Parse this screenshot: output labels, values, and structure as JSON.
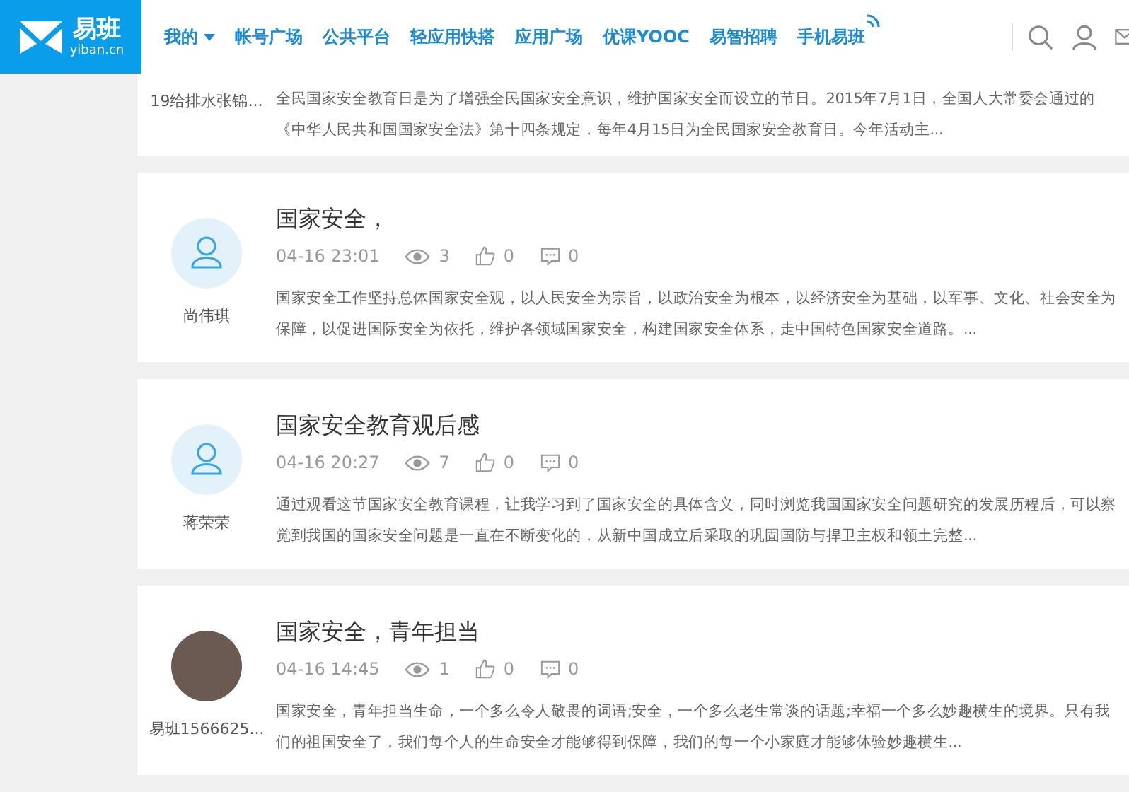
{
  "logo": {
    "name": "易班",
    "domain": "yiban.cn"
  },
  "nav": [
    {
      "label": "我的",
      "dropdown": true,
      "signal": false
    },
    {
      "label": "帐号广场",
      "dropdown": false,
      "signal": false
    },
    {
      "label": "公共平台",
      "dropdown": false,
      "signal": false
    },
    {
      "label": "轻应用快搭",
      "dropdown": false,
      "signal": false
    },
    {
      "label": "应用广场",
      "dropdown": false,
      "signal": false
    },
    {
      "label": "优课YOOC",
      "dropdown": false,
      "signal": false
    },
    {
      "label": "易智招聘",
      "dropdown": false,
      "signal": false
    },
    {
      "label": "手机易班",
      "dropdown": false,
      "signal": true
    }
  ],
  "posts": [
    {
      "user": "19给排水张锦...",
      "excerpt": "全民国家安全教育日是为了增强全民国家安全意识，维护国家安全而设立的节日。2015年7月1日，全国人大常委会通过的《中华人民共和国国家安全法》第十四条规定，每年4月15日为全民国家安全教育日。今年活动主..."
    },
    {
      "kind": "default",
      "user": "尚伟琪",
      "title": "国家安全，",
      "time": "04-16 23:01",
      "views": "3",
      "likes": "0",
      "comments": "0",
      "excerpt": "国家安全工作坚持总体国家安全观，以人民安全为宗旨，以政治安全为根本，以经济安全为基础，以军事、文化、社会安全为保障，以促进国际安全为依托，维护各领域国家安全，构建国家安全体系，走中国特色国家安全道路。..."
    },
    {
      "kind": "default",
      "user": "蒋荣荣",
      "title": "国家安全教育观后感",
      "time": "04-16 20:27",
      "views": "7",
      "likes": "0",
      "comments": "0",
      "excerpt": "通过观看这节国家安全教育课程，让我学习到了国家安全的具体含义，同时浏览我国国家安全问题研究的发展历程后，可以察觉到我国的国家安全问题是一直在不断变化的，从新中国成立后采取的巩固国防与捍卫主权和领土完整..."
    },
    {
      "kind": "photo",
      "user": "易班1566625...",
      "title": "国家安全，青年担当",
      "time": "04-16 14:45",
      "views": "1",
      "likes": "0",
      "comments": "0",
      "excerpt": "国家安全，青年担当生命，一个多么令人敬畏的词语;安全，一个多么老生常谈的话题;幸福一个多么妙趣横生的境界。只有我们的祖国安全了，我们每个人的生命安全才能够得到保障，我们的每一个小家庭才能够体验妙趣横生..."
    }
  ]
}
